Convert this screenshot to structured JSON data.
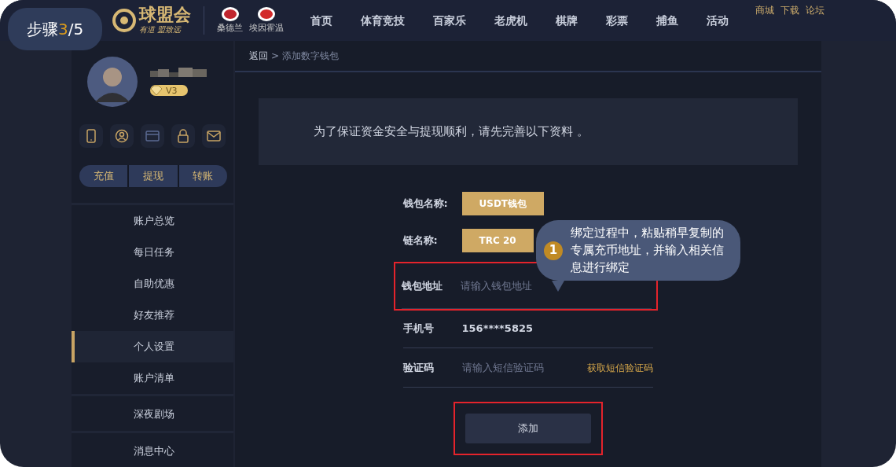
{
  "step_badge": {
    "label": "步骤",
    "current": "3",
    "total": "/5"
  },
  "header": {
    "logo": "球盟会",
    "tagline": "有道 盟致远",
    "clubs": [
      "桑德兰",
      "埃因霍温"
    ],
    "nav": [
      "首页",
      "体育竞技",
      "百家乐",
      "老虎机",
      "棋牌",
      "彩票",
      "捕鱼",
      "活动"
    ],
    "links": [
      "商城",
      "下载",
      "论坛"
    ]
  },
  "profile": {
    "vip": "V3"
  },
  "quick_icons": [
    {
      "kind": "phone",
      "bound": true
    },
    {
      "kind": "user",
      "bound": true
    },
    {
      "kind": "card",
      "bound": false
    },
    {
      "kind": "lock",
      "bound": true
    },
    {
      "kind": "mail",
      "bound": true
    }
  ],
  "wallet_buttons": [
    "充值",
    "提现",
    "转账"
  ],
  "sidebar": {
    "groups": [
      [
        {
          "label": "账户总览",
          "selected": false
        },
        {
          "label": "每日任务",
          "selected": false
        },
        {
          "label": "自助优惠",
          "selected": false
        },
        {
          "label": "好友推荐",
          "selected": false
        },
        {
          "label": "个人设置",
          "selected": true
        },
        {
          "label": "账户清单",
          "selected": false
        }
      ],
      [
        {
          "label": "深夜剧场",
          "selected": false
        }
      ],
      [
        {
          "label": "消息中心",
          "selected": false
        }
      ]
    ]
  },
  "breadcrumb": {
    "back": "返回",
    "separator": ">",
    "current": "添加数字钱包"
  },
  "notice": "为了保证资金安全与提现顺利，请先完善以下资料 。",
  "form": [
    {
      "kind": "tag",
      "label": "钱包名称:",
      "value": "USDT钱包",
      "highlighted": false
    },
    {
      "kind": "tag",
      "label": "链名称:",
      "value": "TRC 20",
      "highlighted": false
    },
    {
      "kind": "input",
      "label": "钱包地址",
      "placeholder": "请输入钱包地址",
      "highlighted": true
    },
    {
      "kind": "text",
      "label": "手机号",
      "value": "156****5825",
      "highlighted": false
    },
    {
      "kind": "code",
      "label": "验证码",
      "placeholder": "请输入短信验证码",
      "action": "获取短信验证码",
      "highlighted": false
    }
  ],
  "submit": {
    "label": "添加",
    "highlighted": true
  },
  "tip": {
    "number": "1",
    "text": "绑定过程中，粘贴稍早复制的专属充币地址，并输入相关信息进行绑定"
  }
}
